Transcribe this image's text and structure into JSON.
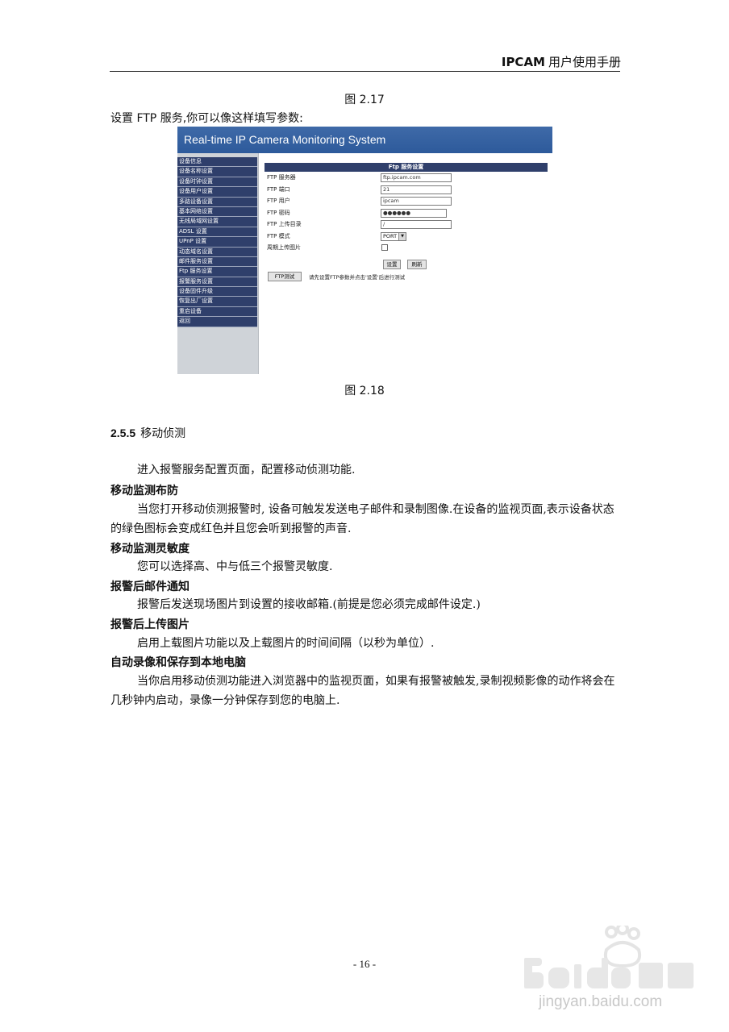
{
  "header": {
    "title": "IPCAM",
    "subtitle": "用户使用手册"
  },
  "figures": {
    "prev_caption": "图  2.17",
    "caption": "图  2.18"
  },
  "intro_line": "设置 FTP 服务,你可以像这样填写参数:",
  "screenshot": {
    "banner": "Real-time IP Camera Monitoring System",
    "menu": [
      "设备信息",
      "设备名称设置",
      "设备时钟设置",
      "设备用户设置",
      "多路设备设置",
      "基本网络设置",
      "无线局域网设置",
      "ADSL 设置",
      "UPnP 设置",
      "动态域名设置",
      "邮件服务设置",
      "Ftp 服务设置",
      "报警服务设置",
      "设备固件升级",
      "恢复出厂设置",
      "重启设备",
      "返回"
    ],
    "panel_title": "Ftp 服务设置",
    "fields": [
      {
        "label": "FTP 服务器",
        "value": "ftp.ipcam.com"
      },
      {
        "label": "FTP 端口",
        "value": "21"
      },
      {
        "label": "FTP 用户",
        "value": "ipcam"
      },
      {
        "label": "FTP 密码",
        "value": "●●●●●●"
      },
      {
        "label": "FTP 上传目录",
        "value": "/"
      },
      {
        "label": "FTP 模式",
        "value": "PORT"
      },
      {
        "label": "周期上传图片",
        "value": ""
      }
    ],
    "set_button": "设置",
    "refresh_button": "刷新",
    "test_button": "FTP测试",
    "hint": "请先设置FTP参数并点击'设置'后进行测试"
  },
  "section": {
    "number": "2.5.5",
    "title": "移动侦测"
  },
  "body": {
    "p1": "进入报警服务配置页面，配置移动侦测功能.",
    "h1": "移动监测布防",
    "p2": "当您打开移动侦测报警时, 设备可触发发送电子邮件和录制图像.在设备的监视页面,表示设备状态的绿色图标会变成红色并且您会听到报警的声音.",
    "h2": "移动监测灵敏度",
    "p3": "您可以选择高、中与低三个报警灵敏度.",
    "h3": "报警后邮件通知",
    "p4": "报警后发送现场图片到设置的接收邮箱.(前提是您必须完成邮件设定.)",
    "h4": "报警后上传图片",
    "p5": "启用上载图片功能以及上载图片的时间间隔（以秒为单位）.",
    "h5": "自动录像和保存到本地电脑",
    "p6": "当你启用移动侦测功能进入浏览器中的监视页面，如果有报警被触发,录制视频影像的动作将会在几秒钟内启动，录像一分钟保存到您的电脑上."
  },
  "page_number": "- 16 -",
  "watermark": {
    "text": "jingyan.baidu.com",
    "logo_text": "Baidu经验"
  }
}
